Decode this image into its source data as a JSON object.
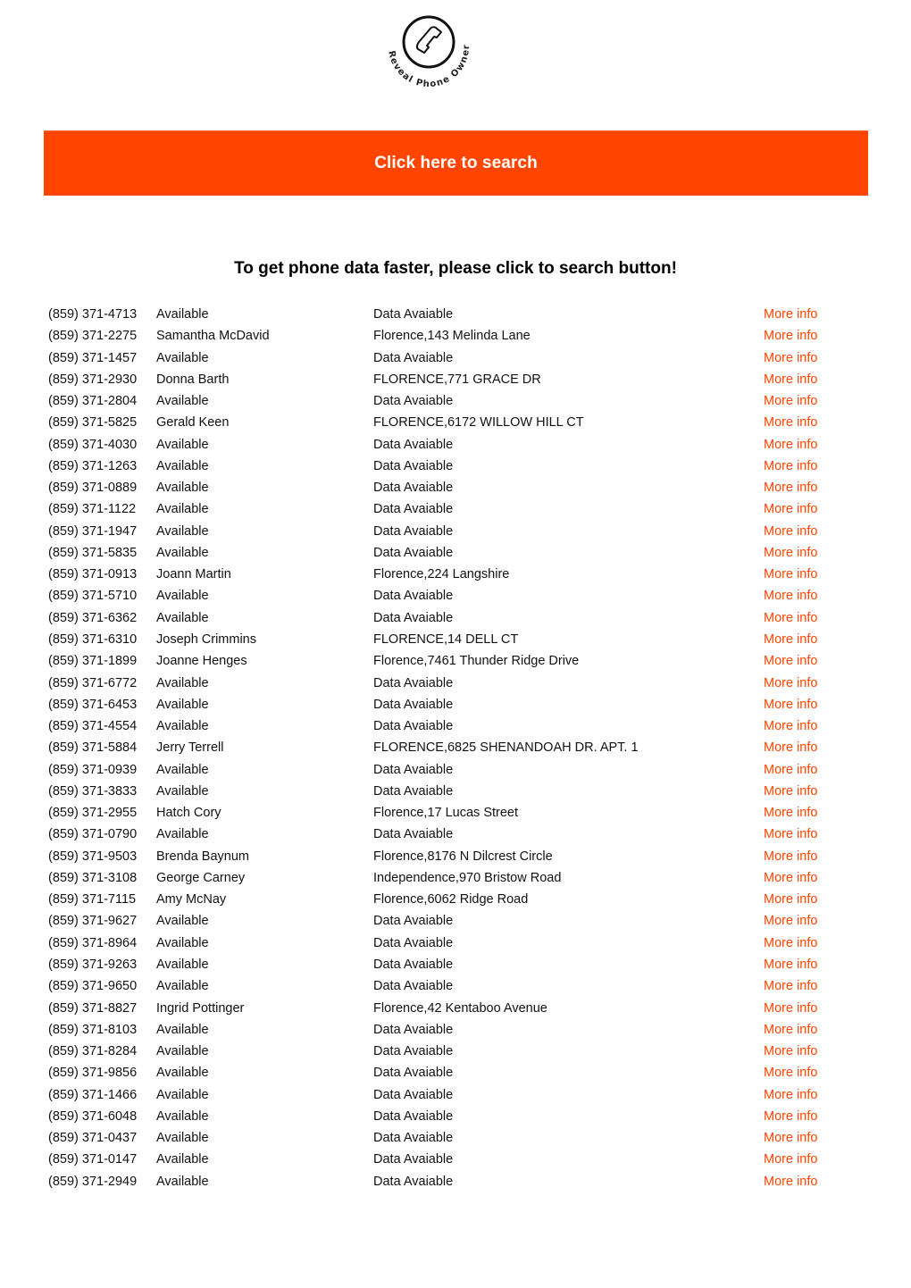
{
  "logo": {
    "text": "Reveal Phone Owner",
    "icon": "phone-handset-icon"
  },
  "banner": {
    "label": "Click here to search",
    "color": "#ff4500"
  },
  "headline": "To get phone data faster, please click to search button!",
  "link_color": "#ff4500",
  "rows": [
    {
      "phone": "(859) 371-4713",
      "name": "Available",
      "address": "Data Avaiable",
      "link": "More info"
    },
    {
      "phone": "(859) 371-2275",
      "name": "Samantha McDavid",
      "address": "Florence,143 Melinda Lane",
      "link": "More info"
    },
    {
      "phone": "(859) 371-1457",
      "name": "Available",
      "address": "Data Avaiable",
      "link": "More info"
    },
    {
      "phone": "(859) 371-2930",
      "name": "Donna Barth",
      "address": "FLORENCE,771 GRACE DR",
      "link": "More info"
    },
    {
      "phone": "(859) 371-2804",
      "name": "Available",
      "address": "Data Avaiable",
      "link": "More info"
    },
    {
      "phone": "(859) 371-5825",
      "name": "Gerald Keen",
      "address": "FLORENCE,6172 WILLOW HILL CT",
      "link": "More info"
    },
    {
      "phone": "(859) 371-4030",
      "name": "Available",
      "address": "Data Avaiable",
      "link": "More info"
    },
    {
      "phone": "(859) 371-1263",
      "name": "Available",
      "address": "Data Avaiable",
      "link": "More info"
    },
    {
      "phone": "(859) 371-0889",
      "name": "Available",
      "address": "Data Avaiable",
      "link": "More info"
    },
    {
      "phone": "(859) 371-1122",
      "name": "Available",
      "address": "Data Avaiable",
      "link": "More info"
    },
    {
      "phone": "(859) 371-1947",
      "name": "Available",
      "address": "Data Avaiable",
      "link": "More info"
    },
    {
      "phone": "(859) 371-5835",
      "name": "Available",
      "address": "Data Avaiable",
      "link": "More info"
    },
    {
      "phone": "(859) 371-0913",
      "name": "Joann Martin",
      "address": "Florence,224 Langshire",
      "link": "More info"
    },
    {
      "phone": "(859) 371-5710",
      "name": "Available",
      "address": "Data Avaiable",
      "link": "More info"
    },
    {
      "phone": "(859) 371-6362",
      "name": "Available",
      "address": "Data Avaiable",
      "link": "More info"
    },
    {
      "phone": "(859) 371-6310",
      "name": "Joseph Crimmins",
      "address": "FLORENCE,14 DELL CT",
      "link": "More info"
    },
    {
      "phone": "(859) 371-1899",
      "name": "Joanne Henges",
      "address": "Florence,7461 Thunder Ridge Drive",
      "link": "More info"
    },
    {
      "phone": "(859) 371-6772",
      "name": "Available",
      "address": "Data Avaiable",
      "link": "More info"
    },
    {
      "phone": "(859) 371-6453",
      "name": "Available",
      "address": "Data Avaiable",
      "link": "More info"
    },
    {
      "phone": "(859) 371-4554",
      "name": "Available",
      "address": "Data Avaiable",
      "link": "More info"
    },
    {
      "phone": "(859) 371-5884",
      "name": "Jerry Terrell",
      "address": "FLORENCE,6825 SHENANDOAH DR.  APT.   1",
      "link": "More info"
    },
    {
      "phone": "(859) 371-0939",
      "name": "Available",
      "address": "Data Avaiable",
      "link": "More info"
    },
    {
      "phone": "(859) 371-3833",
      "name": "Available",
      "address": "Data Avaiable",
      "link": "More info"
    },
    {
      "phone": "(859) 371-2955",
      "name": "Hatch Cory",
      "address": "Florence,17 Lucas Street",
      "link": "More info"
    },
    {
      "phone": "(859) 371-0790",
      "name": "Available",
      "address": "Data Avaiable",
      "link": "More info"
    },
    {
      "phone": "(859) 371-9503",
      "name": "Brenda Baynum",
      "address": "Florence,8176 N Dilcrest Circle",
      "link": "More info"
    },
    {
      "phone": "(859) 371-3108",
      "name": "George Carney",
      "address": "Independence,970 Bristow Road",
      "link": "More info"
    },
    {
      "phone": "(859) 371-7115",
      "name": "Amy McNay",
      "address": "Florence,6062 Ridge Road",
      "link": "More info"
    },
    {
      "phone": "(859) 371-9627",
      "name": "Available",
      "address": "Data Avaiable",
      "link": "More info"
    },
    {
      "phone": "(859) 371-8964",
      "name": "Available",
      "address": "Data Avaiable",
      "link": "More info"
    },
    {
      "phone": "(859) 371-9263",
      "name": "Available",
      "address": "Data Avaiable",
      "link": "More info"
    },
    {
      "phone": "(859) 371-9650",
      "name": "Available",
      "address": "Data Avaiable",
      "link": "More info"
    },
    {
      "phone": "(859) 371-8827",
      "name": "Ingrid Pottinger",
      "address": "Florence,42 Kentaboo Avenue",
      "link": "More info"
    },
    {
      "phone": "(859) 371-8103",
      "name": "Available",
      "address": "Data Avaiable",
      "link": "More info"
    },
    {
      "phone": "(859) 371-8284",
      "name": "Available",
      "address": "Data Avaiable",
      "link": "More info"
    },
    {
      "phone": "(859) 371-9856",
      "name": "Available",
      "address": "Data Avaiable",
      "link": "More info"
    },
    {
      "phone": "(859) 371-1466",
      "name": "Available",
      "address": "Data Avaiable",
      "link": "More info"
    },
    {
      "phone": "(859) 371-6048",
      "name": "Available",
      "address": "Data Avaiable",
      "link": "More info"
    },
    {
      "phone": "(859) 371-0437",
      "name": "Available",
      "address": "Data Avaiable",
      "link": "More info"
    },
    {
      "phone": "(859) 371-0147",
      "name": "Available",
      "address": "Data Avaiable",
      "link": "More info"
    },
    {
      "phone": "(859) 371-2949",
      "name": "Available",
      "address": "Data Avaiable",
      "link": "More info"
    }
  ]
}
